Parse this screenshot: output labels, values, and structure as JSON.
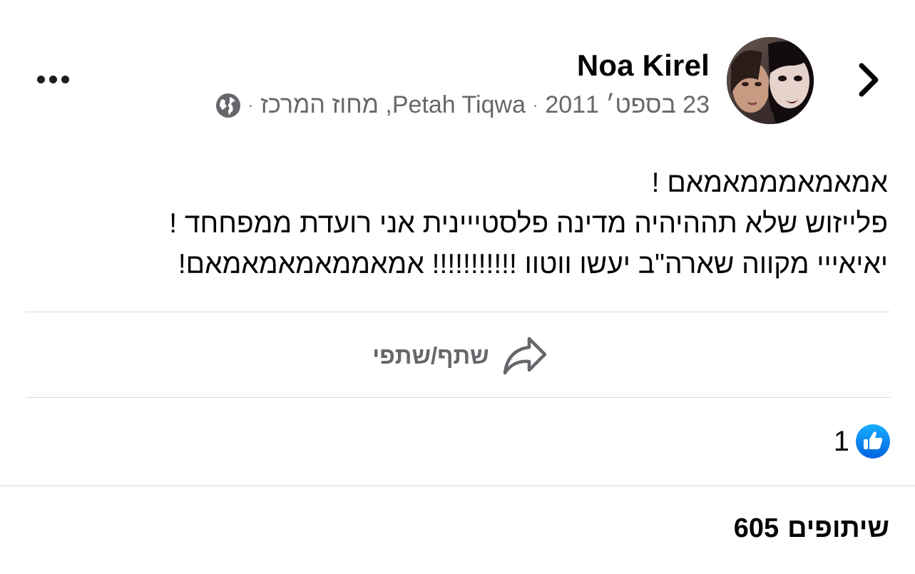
{
  "header": {
    "author": "Noa Kirel",
    "date": "23 בספט׳ 2011",
    "location": "Petah Tiqwa, מחוז המרכז",
    "separator": "·",
    "privacy_icon": "globe-icon",
    "back_icon": "chevron-right-icon",
    "more_icon": "more-dots-icon"
  },
  "post": {
    "lines": [
      "אמאמאמממאמאם !",
      "פלייזוש שלא תההיהיה מדינה פלסטייינית אני רועדת ממפחחד !",
      "יאיאייי מקווה שארה\"ב יעשו ווטוו !!!!!!!!!!! אמאממאמאמאמאם!"
    ]
  },
  "actions": {
    "share_label": "שתף/שתפי",
    "share_icon": "share-arrow-icon"
  },
  "reactions": {
    "count": "1",
    "icon": "like-thumb-icon"
  },
  "shares": {
    "count": "605",
    "label": "שיתופים"
  },
  "colors": {
    "text": "#050505",
    "secondary_text": "#65676b",
    "divider": "#d6d8dc",
    "like_blue": "#1877f2"
  }
}
